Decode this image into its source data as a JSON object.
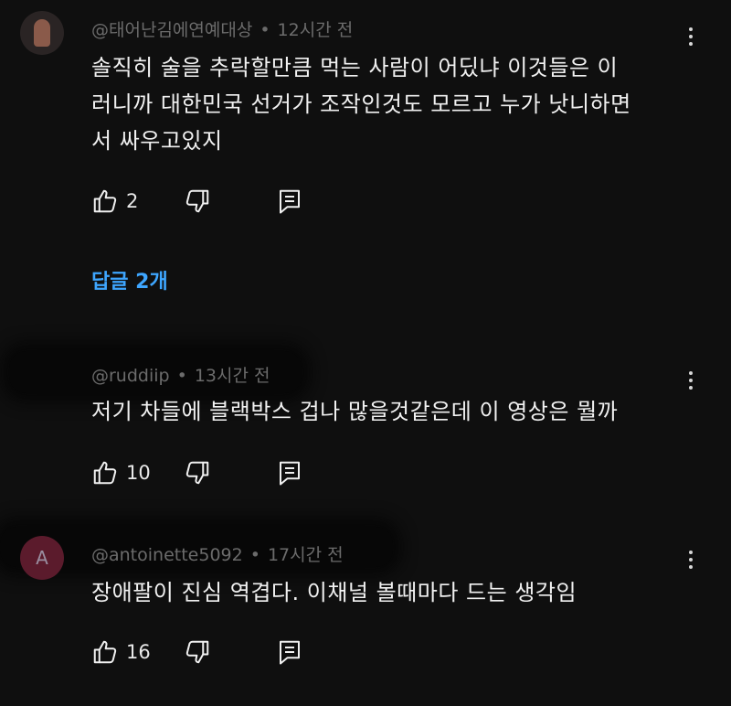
{
  "comments": [
    {
      "avatar": "profile-photo",
      "handle": "@태어난김에연예대상",
      "time": "12시간 전",
      "lines": [
        "솔직히 술을 추락할만큼 먹는 사람이 어딨냐 이것들은 이",
        "러니까 대한민국 선거가 조작인것도 모르고 누가 낫니하면",
        "서 싸우고있지"
      ],
      "likes": "2"
    },
    {
      "avatar": "",
      "handle": "@ruddiip",
      "time": "13시간 전",
      "lines": [
        "저기 차들에 블랙박스 겁나 많을것같은데 이 영상은 뭘까"
      ],
      "likes": "10"
    },
    {
      "avatar": "A",
      "handle": "@antoinette5092",
      "time": "17시간 전",
      "lines": [
        "장애팔이 진심 역겹다. 이채널 볼때마다 드는 생각임"
      ],
      "likes": "16"
    }
  ],
  "replies_label": "답글 2개",
  "icons": [
    "thumbs-up-icon",
    "thumbs-down-icon",
    "reply-icon",
    "more-vert-icon"
  ],
  "colors": {
    "background": "#0f0f0f",
    "link": "#3ea6ff",
    "meta": "#6b6b6b"
  }
}
